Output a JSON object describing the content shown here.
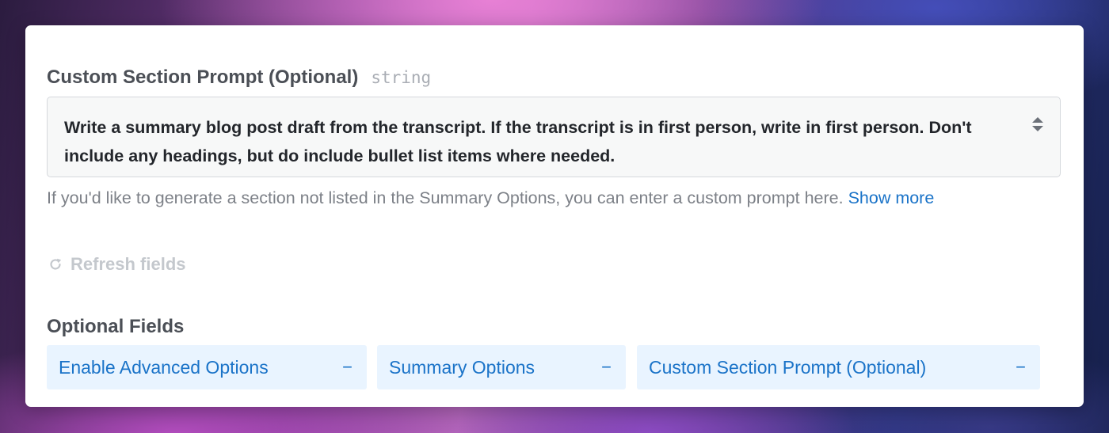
{
  "field": {
    "label": "Custom Section Prompt (Optional)",
    "type": "string",
    "value": "Write a summary blog post draft from the transcript. If the transcript is in first person, write in first person. Don't include any headings, but do include bullet list items where needed.",
    "hint": "If you'd like to generate a section not listed in the Summary Options, you can enter a custom prompt here.",
    "show_more_label": "Show more",
    "stepper_icon": "up-down-arrows-icon"
  },
  "refresh": {
    "label": "Refresh fields",
    "icon": "refresh-icon"
  },
  "optional_fields": {
    "title": "Optional Fields",
    "chips": [
      {
        "label": "Enable Advanced Options",
        "action": "−"
      },
      {
        "label": "Summary Options",
        "action": "−"
      },
      {
        "label": "Custom Section Prompt (Optional)",
        "action": "−"
      }
    ]
  },
  "colors": {
    "accent": "#1a73c8",
    "chip_background": "#e9f4ff",
    "disabled_text": "#c4c8cd"
  }
}
